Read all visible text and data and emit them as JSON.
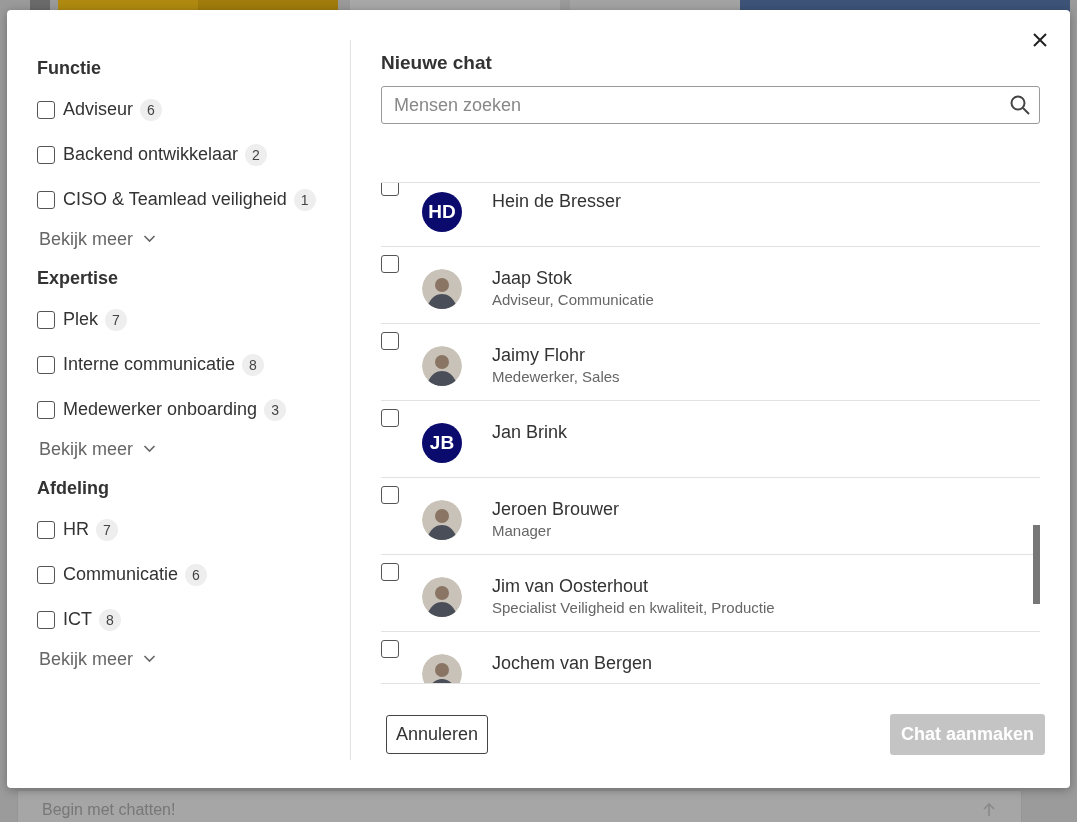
{
  "background": {
    "message_placeholder": "Begin met chatten!"
  },
  "filters": [
    {
      "title": "Functie",
      "options": [
        {
          "label": "Adviseur",
          "count": "6",
          "checked": false
        },
        {
          "label": "Backend ontwikkelaar",
          "count": "2",
          "checked": false
        },
        {
          "label": "CISO & Teamlead veiligheid",
          "count": "1",
          "checked": false
        }
      ],
      "more": "Bekijk meer"
    },
    {
      "title": "Expertise",
      "options": [
        {
          "label": "Plek",
          "count": "7",
          "checked": false
        },
        {
          "label": "Interne communicatie",
          "count": "8",
          "checked": false
        },
        {
          "label": "Medewerker onboarding",
          "count": "3",
          "checked": false
        }
      ],
      "more": "Bekijk meer"
    },
    {
      "title": "Afdeling",
      "options": [
        {
          "label": "HR",
          "count": "7",
          "checked": false
        },
        {
          "label": "Communicatie",
          "count": "6",
          "checked": false
        },
        {
          "label": "ICT",
          "count": "8",
          "checked": false
        }
      ],
      "more": "Bekijk meer"
    }
  ],
  "dialog": {
    "title": "Nieuwe chat",
    "search": {
      "placeholder": "Mensen zoeken"
    },
    "people": [
      {
        "name": "Hein de Bresser",
        "avatar": {
          "kind": "initials",
          "text": "HD"
        },
        "checked": false
      },
      {
        "name": "Jaap Stok",
        "subtitle": "Adviseur, Communicatie",
        "checked": false
      },
      {
        "name": "Jaimy Flohr",
        "subtitle": "Medewerker, Sales",
        "checked": false
      },
      {
        "name": "Jan Brink",
        "avatar": {
          "kind": "initials",
          "text": "JB"
        },
        "checked": false
      },
      {
        "name": "Jeroen Brouwer",
        "subtitle": "Manager",
        "checked": false
      },
      {
        "name": "Jim van Oosterhout",
        "subtitle": "Specialist Veiligheid en kwaliteit, Productie",
        "checked": false
      },
      {
        "name": "Jochem van Bergen",
        "checked": false
      }
    ],
    "cancel": "Annuleren",
    "create": {
      "label": "Chat aanmaken",
      "disabled": true
    }
  }
}
